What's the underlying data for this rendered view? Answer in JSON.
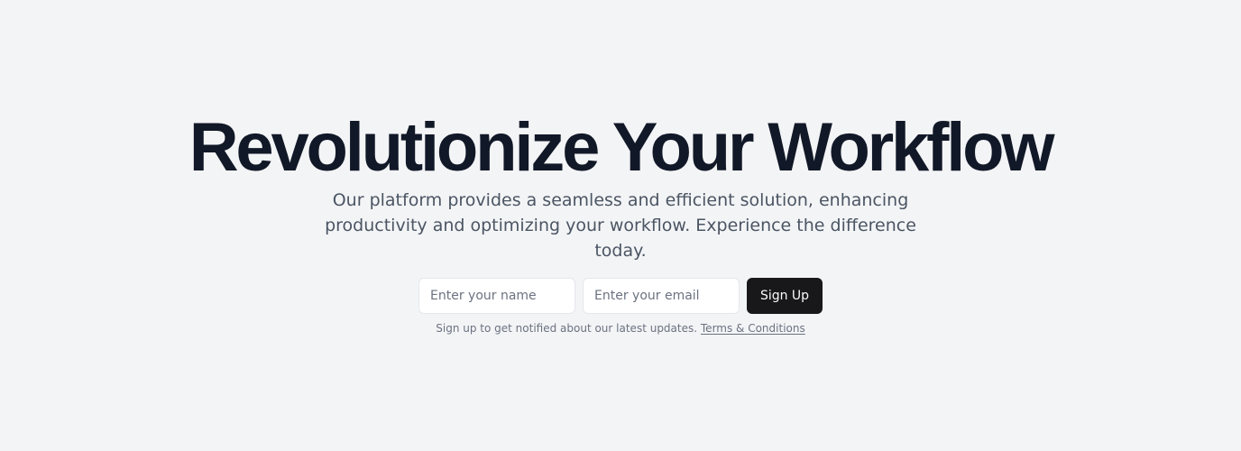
{
  "hero": {
    "headline": "Revolutionize Your Workflow",
    "subtitle": "Our platform provides a seamless and efficient solution, enhancing productivity and optimizing your workflow. Experience the difference today."
  },
  "form": {
    "name_placeholder": "Enter your name",
    "email_placeholder": "Enter your email",
    "name_value": "",
    "email_value": "",
    "submit_label": "Sign Up"
  },
  "footer_note": {
    "text": "Sign up to get notified about our latest updates.",
    "terms_link": "Terms & Conditions"
  },
  "colors": {
    "background": "#f3f4f6",
    "headline": "#111827",
    "subtitle": "#4b5563",
    "button_bg": "#18181b",
    "button_text": "#fafafa",
    "muted_text": "#6b7280"
  }
}
